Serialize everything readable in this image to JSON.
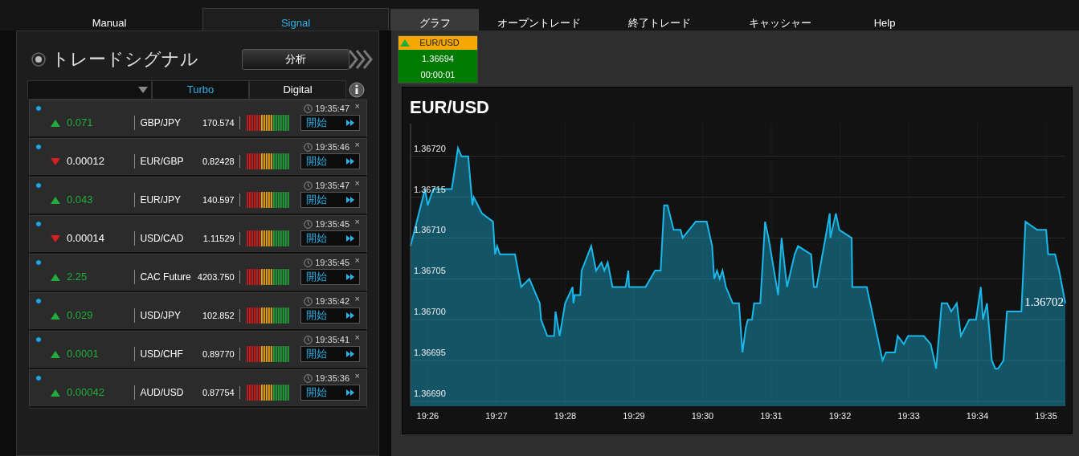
{
  "top_tabs": [
    {
      "label": "Manual",
      "selected": false
    },
    {
      "label": "Signal",
      "selected": true
    }
  ],
  "main_tabs": [
    {
      "label": "グラフ",
      "selected": true
    },
    {
      "label": "オープントレード",
      "selected": false
    },
    {
      "label": "終了トレード",
      "selected": false
    },
    {
      "label": "キャッシャー",
      "selected": false
    },
    {
      "label": "Help",
      "selected": false
    }
  ],
  "signal_panel": {
    "title": "トレードシグナル",
    "analysis_button": "分析",
    "filters": [
      {
        "label": "Turbo",
        "selected": true
      },
      {
        "label": "Digital",
        "selected": false
      }
    ],
    "signals": [
      {
        "rising": true,
        "change": "0.071",
        "pair": "GBP/JPY",
        "price": "170.574",
        "time": "19:35:47",
        "close": "×",
        "button": "開始"
      },
      {
        "rising": false,
        "change": "0.00012",
        "pair": "EUR/GBP",
        "price": "0.82428",
        "time": "19:35:46",
        "close": "×",
        "button": "開始"
      },
      {
        "rising": true,
        "change": "0.043",
        "pair": "EUR/JPY",
        "price": "140.597",
        "time": "19:35:47",
        "close": "×",
        "button": "開始"
      },
      {
        "rising": false,
        "change": "0.00014",
        "pair": "USD/CAD",
        "price": "1.11529",
        "time": "19:35:45",
        "close": "×",
        "button": "開始"
      },
      {
        "rising": true,
        "change": "2.25",
        "pair": "CAC Future",
        "price": "4203.750",
        "time": "19:35:45",
        "close": "×",
        "button": "開始"
      },
      {
        "rising": true,
        "change": "0.029",
        "pair": "USD/JPY",
        "price": "102.852",
        "time": "19:35:42",
        "close": "×",
        "button": "開始"
      },
      {
        "rising": true,
        "change": "0.0001",
        "pair": "USD/CHF",
        "price": "0.89770",
        "time": "19:35:41",
        "close": "×",
        "button": "開始"
      },
      {
        "rising": true,
        "change": "0.00042",
        "pair": "AUD/USD",
        "price": "0.87754",
        "time": "19:35:36",
        "close": "×",
        "button": "開始"
      }
    ]
  },
  "ticker": {
    "rising": true,
    "pair": "EUR/USD",
    "price": "1.36694",
    "timer": "00:00:01"
  },
  "chart": {
    "chart_data": {
      "type": "area",
      "title": "EUR/USD",
      "grid": true,
      "x": [
        1165.75,
        1165.96,
        1166,
        1166.08,
        1166.35,
        1166.44,
        1166.49,
        1166.59,
        1166.65,
        1166.67,
        1166.79,
        1166.95,
        1166.98,
        1167.01,
        1167.05,
        1167.27,
        1167.36,
        1167.48,
        1167.63,
        1167.65,
        1167.74,
        1167.84,
        1167.86,
        1167.92,
        1168.0,
        1168.11,
        1168.12,
        1168.14,
        1168.22,
        1168.24,
        1168.38,
        1168.45,
        1168.53,
        1168.57,
        1168.62,
        1168.69,
        1168.88,
        1168.92,
        1168.93,
        1169.17,
        1169.31,
        1169.39,
        1169.44,
        1169.49,
        1169.58,
        1169.68,
        1169.71,
        1169.9,
        1170.06,
        1170.14,
        1170.17,
        1170.21,
        1170.25,
        1170.29,
        1170.34,
        1170.44,
        1170.53,
        1170.58,
        1170.63,
        1170.66,
        1170.72,
        1170.75,
        1170.84,
        1170.91,
        1170.96,
        1171.1,
        1171.15,
        1171.23,
        1171.34,
        1171.39,
        1171.58,
        1171.62,
        1171.66,
        1171.81,
        1171.85,
        1171.86,
        1171.94,
        1171.99,
        1172.17,
        1172.18,
        1172.39,
        1172.62,
        1172.67,
        1172.8,
        1172.84,
        1172.93,
        1172.99,
        1173.22,
        1173.32,
        1173.4,
        1173.48,
        1173.56,
        1173.62,
        1173.7,
        1173.76,
        1173.88,
        1173.98,
        1174.05,
        1174.08,
        1174.14,
        1174.21,
        1174.26,
        1174.3,
        1174.38,
        1174.43,
        1174.64,
        1174.7,
        1174.87,
        1175.0,
        1175.03,
        1175.13,
        1175.19,
        1175.28
      ],
      "series": [
        {
          "color": "#1ab8e8",
          "values": [
            1.36709,
            1.36716,
            1.36714,
            1.36716,
            1.36716,
            1.36721,
            1.3672,
            1.3672,
            1.36714,
            1.36715,
            1.36713,
            1.36712,
            1.36708,
            1.36709,
            1.36708,
            1.36708,
            1.36704,
            1.36705,
            1.36702,
            1.367,
            1.36698,
            1.36698,
            1.36701,
            1.36698,
            1.36702,
            1.36704,
            1.36702,
            1.36703,
            1.36703,
            1.36706,
            1.36709,
            1.36706,
            1.36707,
            1.36706,
            1.36707,
            1.36704,
            1.36704,
            1.36706,
            1.36704,
            1.36704,
            1.36706,
            1.36706,
            1.36714,
            1.36714,
            1.36711,
            1.36711,
            1.3671,
            1.36712,
            1.36712,
            1.36709,
            1.36705,
            1.36706,
            1.36705,
            1.36706,
            1.36704,
            1.36702,
            1.36702,
            1.36696,
            1.36699,
            1.367,
            1.367,
            1.36702,
            1.36702,
            1.36712,
            1.3671,
            1.36703,
            1.3671,
            1.36704,
            1.36708,
            1.36709,
            1.36708,
            1.36704,
            1.36704,
            1.36711,
            1.36713,
            1.3671,
            1.36713,
            1.36711,
            1.3671,
            1.36704,
            1.36704,
            1.36695,
            1.36696,
            1.36696,
            1.36698,
            1.36697,
            1.36698,
            1.36698,
            1.36697,
            1.36694,
            1.36702,
            1.36702,
            1.36701,
            1.36702,
            1.36698,
            1.367,
            1.367,
            1.36704,
            1.367,
            1.36702,
            1.36695,
            1.36694,
            1.36694,
            1.36695,
            1.36701,
            1.36701,
            1.36712,
            1.36711,
            1.36711,
            1.36708,
            1.36708,
            1.36706,
            1.36702
          ]
        }
      ],
      "xlim": [
        1165.75,
        1175.28
      ],
      "ylim": [
        1.366894,
        1.36724
      ],
      "xticks": [
        {
          "value": 1166,
          "label": "19:26"
        },
        {
          "value": 1167,
          "label": "19:27"
        },
        {
          "value": 1168,
          "label": "19:28"
        },
        {
          "value": 1169,
          "label": "19:29"
        },
        {
          "value": 1170,
          "label": "19:30"
        },
        {
          "value": 1171,
          "label": "19:31"
        },
        {
          "value": 1172,
          "label": "19:32"
        },
        {
          "value": 1173,
          "label": "19:33"
        },
        {
          "value": 1174,
          "label": "19:34"
        },
        {
          "value": 1175,
          "label": "19:35"
        }
      ],
      "yticks": [
        {
          "value": 1.3669,
          "label": "1.36690"
        },
        {
          "value": 1.36695,
          "label": "1.36695"
        },
        {
          "value": 1.367,
          "label": "1.36700"
        },
        {
          "value": 1.36705,
          "label": "1.36705"
        },
        {
          "value": 1.3671,
          "label": "1.36710"
        },
        {
          "value": 1.36715,
          "label": "1.36715"
        },
        {
          "value": 1.3672,
          "label": "1.36720"
        }
      ],
      "annotations": [
        {
          "text": "1.36702"
        }
      ]
    }
  }
}
